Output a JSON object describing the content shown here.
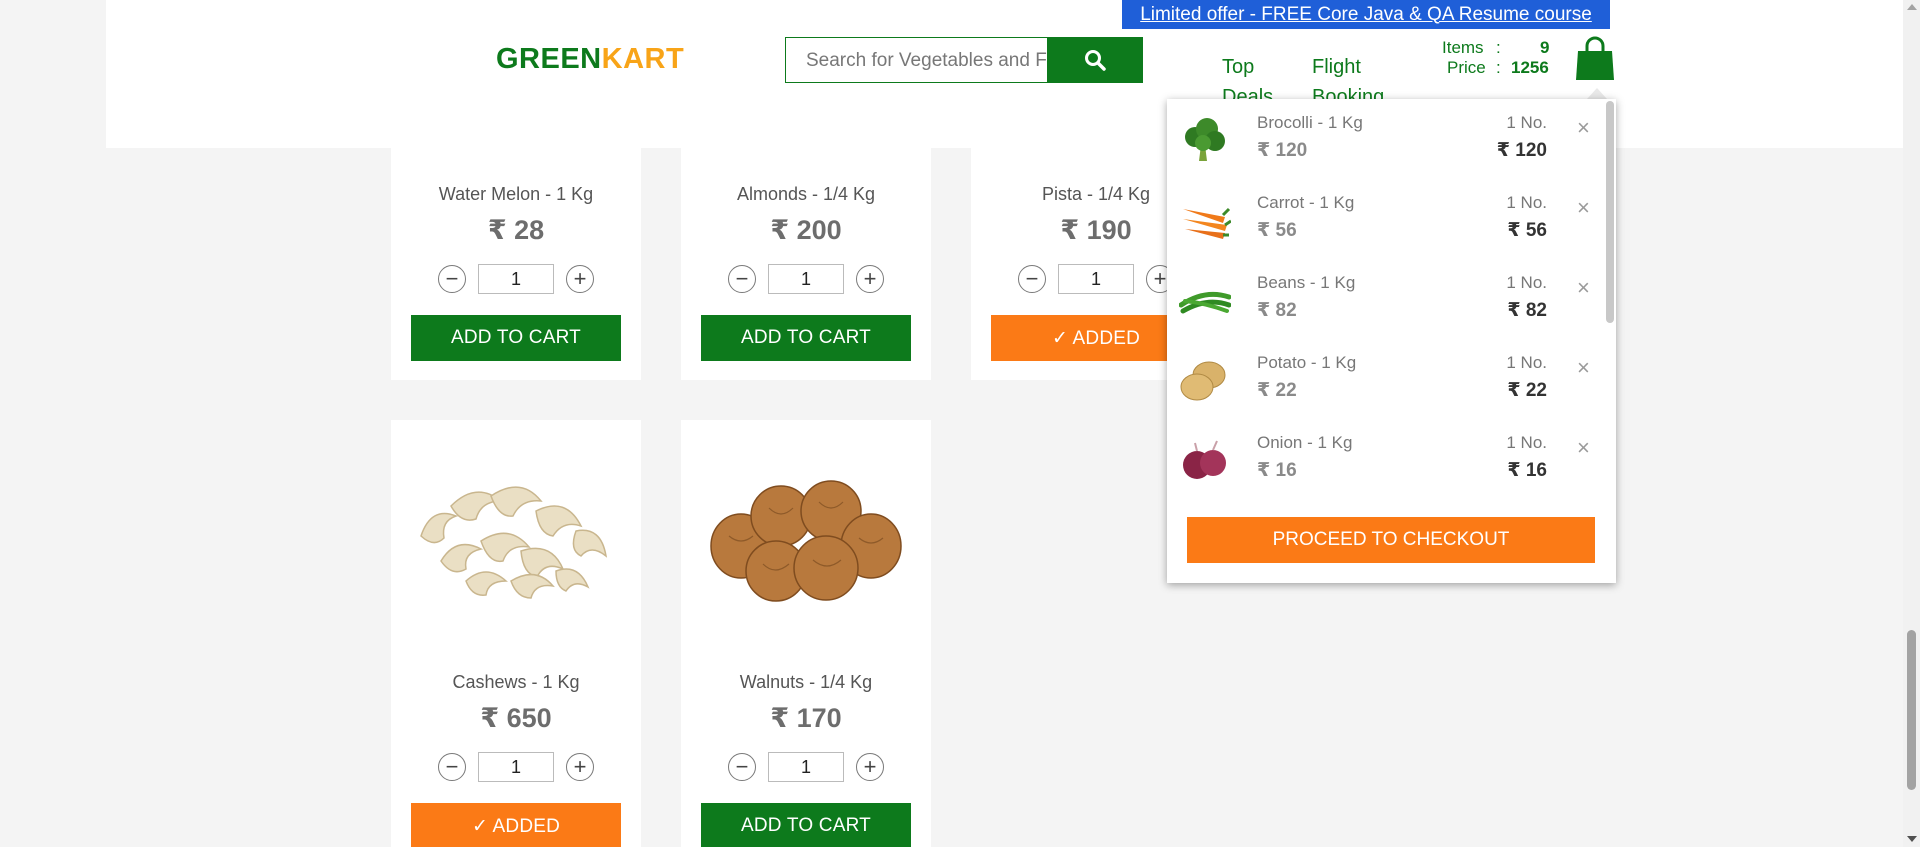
{
  "header": {
    "logo": {
      "green": "GREEN",
      "orange": "KART"
    },
    "search": {
      "placeholder": "Search for Vegetables and Fruits"
    },
    "nav": [
      {
        "line1": "Top",
        "line2": "Deals"
      },
      {
        "line1": "Flight",
        "line2": "Booking"
      }
    ],
    "offer_banner": "Limited offer - FREE Core Java & QA Resume course",
    "stats": {
      "items_label": "Items",
      "items_value": "9",
      "price_label": "Price",
      "price_value": "1256",
      "separator": ":"
    },
    "cart_icon": "shopping-bag-icon"
  },
  "products": [
    {
      "name": "Water Melon - 1 Kg",
      "price": "₹ 28",
      "qty": "1",
      "button": "ADD TO CART",
      "state": "add"
    },
    {
      "name": "Almonds - 1/4 Kg",
      "price": "₹ 200",
      "qty": "1",
      "button": "ADD TO CART",
      "state": "add"
    },
    {
      "name": "Pista - 1/4 Kg",
      "price": "₹ 190",
      "qty": "1",
      "button": "✓ ADDED",
      "state": "added"
    },
    {
      "name": "Cashews - 1 Kg",
      "price": "₹ 650",
      "qty": "1",
      "button": "✓ ADDED",
      "state": "added"
    },
    {
      "name": "Walnuts - 1/4 Kg",
      "price": "₹ 170",
      "qty": "1",
      "button": "ADD TO CART",
      "state": "add"
    }
  ],
  "stepper": {
    "minus": "−",
    "plus": "+"
  },
  "cart_preview": {
    "items": [
      {
        "name": "Brocolli - 1 Kg",
        "price": "₹ 120",
        "qty": "1 No.",
        "total": "₹ 120",
        "icon": "broccoli-icon"
      },
      {
        "name": "Carrot - 1 Kg",
        "price": "₹ 56",
        "qty": "1 No.",
        "total": "₹ 56",
        "icon": "carrot-icon"
      },
      {
        "name": "Beans - 1 Kg",
        "price": "₹ 82",
        "qty": "1 No.",
        "total": "₹ 82",
        "icon": "beans-icon"
      },
      {
        "name": "Potato - 1 Kg",
        "price": "₹ 22",
        "qty": "1 No.",
        "total": "₹ 22",
        "icon": "potato-icon"
      },
      {
        "name": "Onion - 1 Kg",
        "price": "₹ 16",
        "qty": "1 No.",
        "total": "₹ 16",
        "icon": "onion-icon"
      }
    ],
    "remove_symbol": "×",
    "checkout": "PROCEED TO CHECKOUT"
  },
  "colors": {
    "brand_green": "#0d7a1c",
    "brand_orange": "#fb7a16",
    "logo_orange": "#f8a418",
    "offer_blue": "#1f5fd8"
  }
}
